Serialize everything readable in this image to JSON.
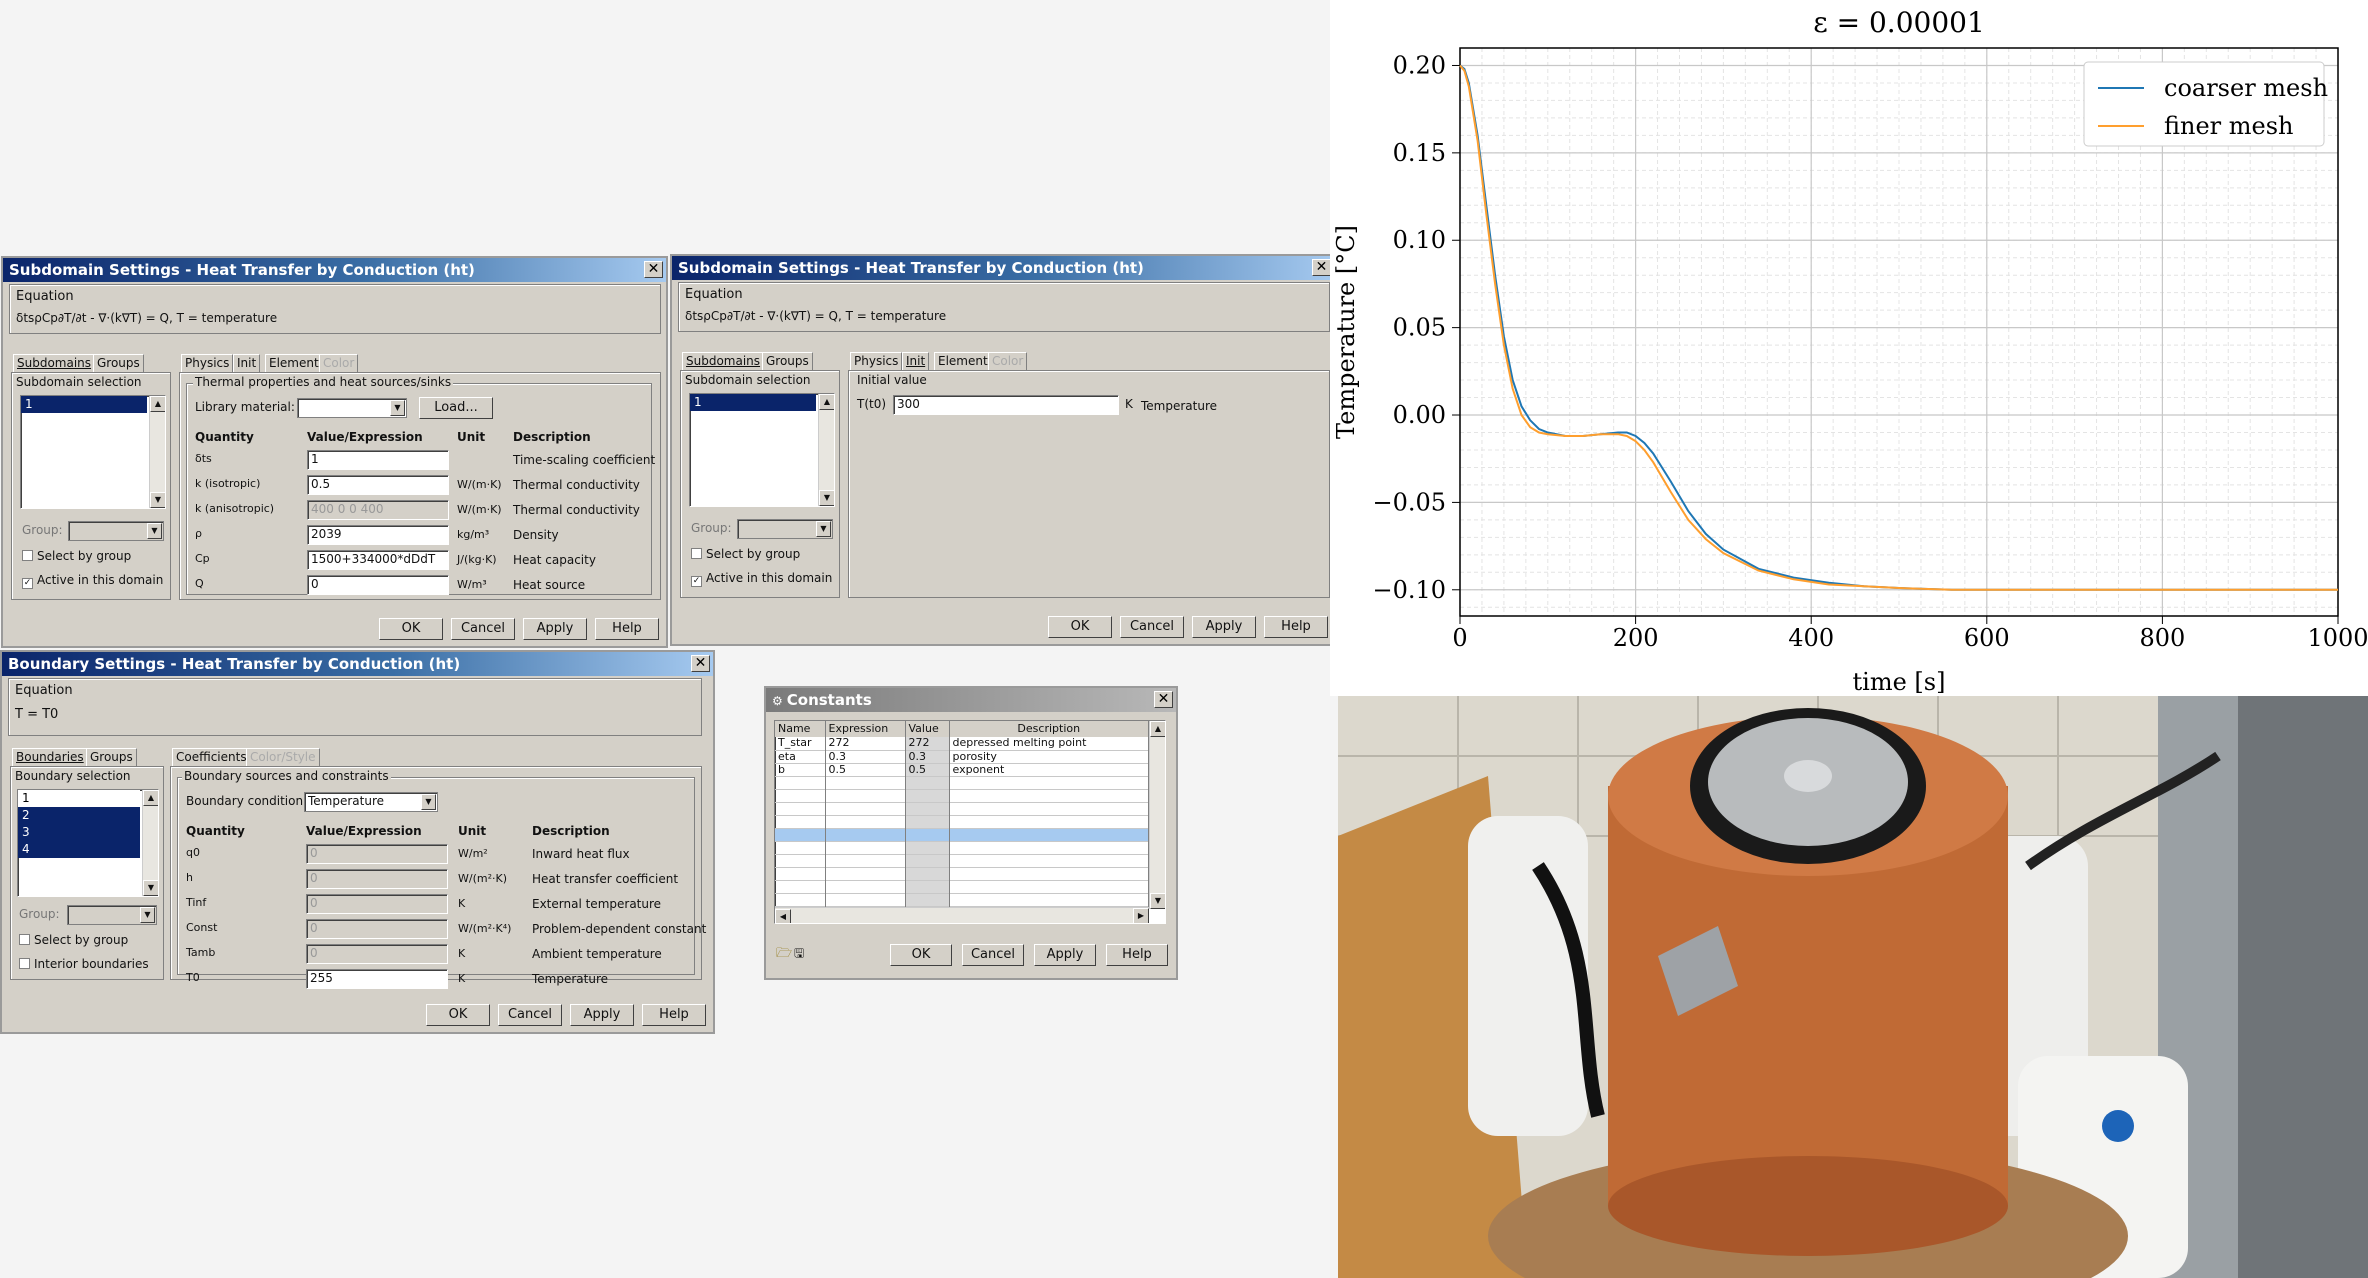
{
  "sub1": {
    "title": "Subdomain Settings - Heat Transfer by Conduction (ht)",
    "close": "✕",
    "equation_label": "Equation",
    "equation": "δtsρCp∂T/∂t - ∇·(k∇T) = Q, T = temperature",
    "left_tabs": [
      "Subdomains",
      "Groups"
    ],
    "selection_label": "Subdomain selection",
    "selection_items": [
      "1"
    ],
    "group_label": "Group:",
    "select_by_group": "Select by group",
    "active_in_domain": "Active in this domain",
    "right_tabs": [
      "Physics",
      "Init",
      "Element",
      "Color"
    ],
    "group_box": "Thermal properties and heat sources/sinks",
    "library_label": "Library material:",
    "load_button": "Load...",
    "headers": [
      "Quantity",
      "Value/Expression",
      "Unit",
      "Description"
    ],
    "rows": [
      {
        "q": "δts",
        "v": "1",
        "u": "",
        "d": "Time-scaling coefficient",
        "dis": false
      },
      {
        "q": "k (isotropic)",
        "v": "0.5",
        "u": "W/(m·K)",
        "d": "Thermal conductivity",
        "dis": false
      },
      {
        "q": "k (anisotropic)",
        "v": "400 0 0 400",
        "u": "W/(m·K)",
        "d": "Thermal conductivity",
        "dis": true
      },
      {
        "q": "ρ",
        "v": "2039",
        "u": "kg/m³",
        "d": "Density",
        "dis": false
      },
      {
        "q": "Cp",
        "v": "1500+334000*dDdT",
        "u": "J/(kg·K)",
        "d": "Heat capacity",
        "dis": false
      },
      {
        "q": "Q",
        "v": "0",
        "u": "W/m³",
        "d": "Heat source",
        "dis": false
      }
    ],
    "buttons": [
      "OK",
      "Cancel",
      "Apply",
      "Help"
    ]
  },
  "sub2": {
    "title": "Subdomain Settings - Heat Transfer by Conduction (ht)",
    "close": "✕",
    "equation_label": "Equation",
    "equation": "δtsρCp∂T/∂t - ∇·(k∇T) = Q, T = temperature",
    "left_tabs": [
      "Subdomains",
      "Groups"
    ],
    "selection_label": "Subdomain selection",
    "selection_items": [
      "1"
    ],
    "group_label": "Group:",
    "select_by_group": "Select by group",
    "active_in_domain": "Active in this domain",
    "right_tabs": [
      "Physics",
      "Init",
      "Element",
      "Color"
    ],
    "init_group": "Initial value",
    "init_q": "T(t0)",
    "init_v": "300",
    "init_u": "K",
    "init_d": "Temperature",
    "buttons": [
      "OK",
      "Cancel",
      "Apply",
      "Help"
    ]
  },
  "bnd": {
    "title": "Boundary Settings - Heat Transfer by Conduction (ht)",
    "close": "✕",
    "equation_label": "Equation",
    "equation": "T = T0",
    "left_tabs": [
      "Boundaries",
      "Groups"
    ],
    "selection_label": "Boundary selection",
    "selection_items": [
      "1",
      "2",
      "3",
      "4"
    ],
    "group_label": "Group:",
    "select_by_group": "Select by group",
    "interior": "Interior boundaries",
    "right_tabs": [
      "Coefficients",
      "Color/Style"
    ],
    "group_box": "Boundary sources and constraints",
    "cond_label": "Boundary condition:",
    "cond_value": "Temperature",
    "headers": [
      "Quantity",
      "Value/Expression",
      "Unit",
      "Description"
    ],
    "rows": [
      {
        "q": "q0",
        "v": "0",
        "u": "W/m²",
        "d": "Inward heat flux",
        "dis": true
      },
      {
        "q": "h",
        "v": "0",
        "u": "W/(m²·K)",
        "d": "Heat transfer coefficient",
        "dis": true
      },
      {
        "q": "Tinf",
        "v": "0",
        "u": "K",
        "d": "External temperature",
        "dis": true
      },
      {
        "q": "Const",
        "v": "0",
        "u": "W/(m²·K⁴)",
        "d": "Problem-dependent constant",
        "dis": true
      },
      {
        "q": "Tamb",
        "v": "0",
        "u": "K",
        "d": "Ambient temperature",
        "dis": true
      },
      {
        "q": "T0",
        "v": "255",
        "u": "K",
        "d": "Temperature",
        "dis": false
      }
    ],
    "buttons": [
      "OK",
      "Cancel",
      "Apply",
      "Help"
    ]
  },
  "consts": {
    "title": "Constants",
    "close": "✕",
    "headers": [
      "Name",
      "Expression",
      "Value",
      "Description"
    ],
    "rows": [
      [
        "T_star",
        "272",
        "272",
        "depressed melting point"
      ],
      [
        "eta",
        "0.3",
        "0.3",
        "porosity"
      ],
      [
        "b",
        "0.5",
        "0.5",
        "exponent"
      ]
    ],
    "buttons": [
      "OK",
      "Cancel",
      "Apply",
      "Help"
    ]
  },
  "chart_data": {
    "type": "line",
    "title": "ε = 0.00001",
    "xlabel": "time [s]",
    "ylabel": "Temperature [°C]",
    "xlim": [
      0,
      1000
    ],
    "ylim": [
      -0.115,
      0.21
    ],
    "xticks": [
      0,
      200,
      400,
      600,
      800,
      1000
    ],
    "yticks": [
      0.2,
      0.15,
      0.1,
      0.05,
      0.0,
      -0.05,
      -0.1
    ],
    "ytick_labels": [
      "0.20",
      "0.15",
      "0.10",
      "0.05",
      "0.00",
      "−0.05",
      "−0.10"
    ],
    "grid": true,
    "legend": "top-right",
    "series": [
      {
        "name": "coarser mesh",
        "color": "#1f77b4",
        "x": [
          0,
          5,
          10,
          20,
          30,
          40,
          50,
          60,
          70,
          80,
          90,
          100,
          120,
          140,
          160,
          180,
          190,
          200,
          210,
          220,
          240,
          260,
          280,
          300,
          340,
          380,
          420,
          460,
          500,
          560,
          620,
          700,
          800,
          900,
          1000
        ],
        "y": [
          0.2,
          0.198,
          0.19,
          0.16,
          0.12,
          0.08,
          0.045,
          0.02,
          0.005,
          -0.003,
          -0.008,
          -0.01,
          -0.012,
          -0.012,
          -0.011,
          -0.01,
          -0.01,
          -0.012,
          -0.016,
          -0.022,
          -0.038,
          -0.055,
          -0.068,
          -0.077,
          -0.088,
          -0.093,
          -0.096,
          -0.098,
          -0.099,
          -0.1,
          -0.1,
          -0.1,
          -0.1,
          -0.1,
          -0.1
        ]
      },
      {
        "name": "finer mesh",
        "color": "#ff9f2e",
        "x": [
          0,
          5,
          10,
          20,
          30,
          40,
          50,
          60,
          70,
          80,
          90,
          100,
          120,
          140,
          160,
          180,
          190,
          200,
          210,
          220,
          240,
          260,
          280,
          300,
          340,
          380,
          420,
          460,
          500,
          560,
          620,
          700,
          800,
          900,
          1000
        ],
        "y": [
          0.2,
          0.197,
          0.188,
          0.157,
          0.115,
          0.075,
          0.04,
          0.015,
          0.0,
          -0.007,
          -0.01,
          -0.011,
          -0.012,
          -0.012,
          -0.011,
          -0.011,
          -0.012,
          -0.015,
          -0.02,
          -0.027,
          -0.044,
          -0.06,
          -0.071,
          -0.079,
          -0.089,
          -0.094,
          -0.097,
          -0.098,
          -0.099,
          -0.1,
          -0.1,
          -0.1,
          -0.1,
          -0.1,
          -0.1
        ]
      }
    ]
  }
}
